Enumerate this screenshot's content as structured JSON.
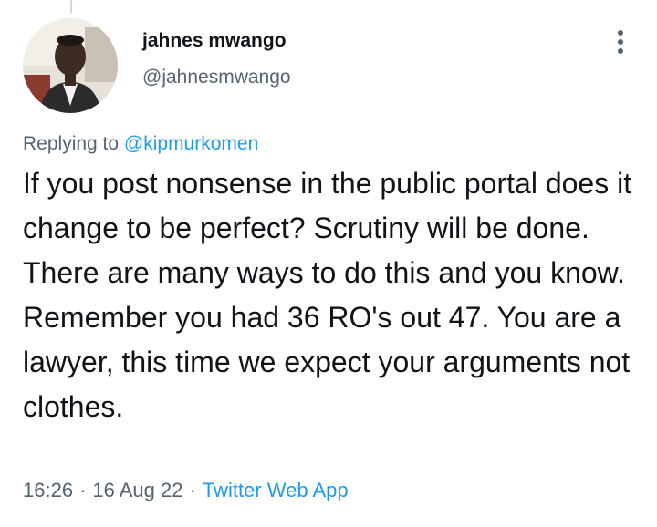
{
  "author": {
    "display_name": "jahnes mwango",
    "handle": "@jahnesmwango",
    "avatar_icon": "user-avatar-photo"
  },
  "reply": {
    "prefix": "Replying to",
    "mention": "@kipmurkomen"
  },
  "tweet": {
    "text": "If you post nonsense in the public portal does it change to be perfect? Scrutiny will be done. There are many ways to do this and you know. Remember you had 36 RO's out 47. You are a lawyer, this time we expect your arguments not clothes."
  },
  "meta": {
    "time": "16:26",
    "date": "16 Aug 22",
    "separator": "·",
    "source": "Twitter Web App"
  },
  "menu_icon": "more-vertical-icon",
  "colors": {
    "text": "#0f1419",
    "secondary": "#536471",
    "link": "#1d9bf0"
  }
}
